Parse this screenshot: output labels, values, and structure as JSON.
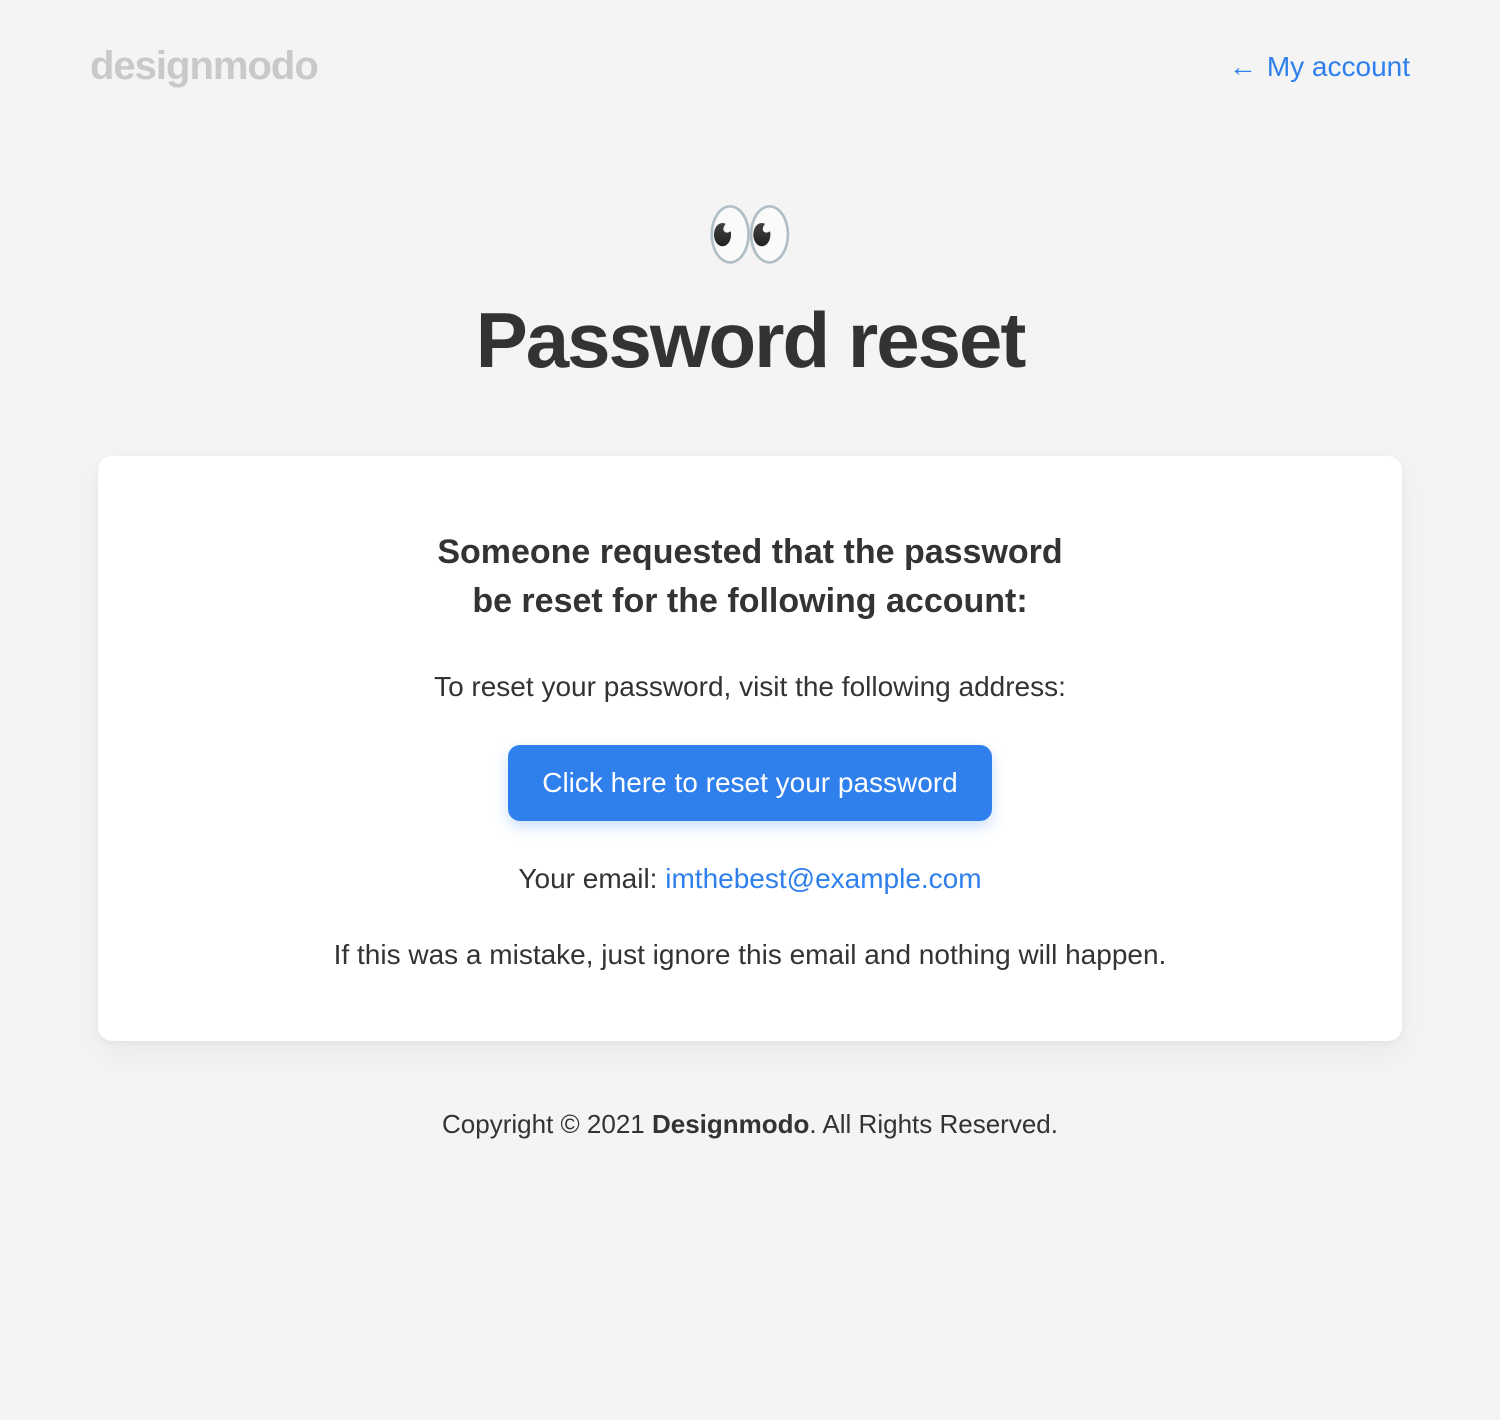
{
  "header": {
    "logo_text": "designmodo",
    "account_link_label": "My account",
    "arrow_glyph": "←"
  },
  "hero": {
    "emoji": "👀",
    "title": "Password reset"
  },
  "card": {
    "lead": "Someone requested that the password be reset for the following account:",
    "instruction": "To reset your password, visit the following address:",
    "button_label": "Click here to reset your password",
    "email_label": "Your email: ",
    "email_value": "imthebest@example.com",
    "mistake_note": "If this was a mistake, just ignore this email and nothing will happen."
  },
  "footer": {
    "prefix": "Copyright © 2021 ",
    "brand": "Designmodo",
    "suffix": ". All Rights Reserved."
  },
  "colors": {
    "accent": "#2f80ed",
    "bg": "#f4f4f4",
    "card": "#ffffff",
    "text": "#333333",
    "logo": "#c9c9c9"
  }
}
